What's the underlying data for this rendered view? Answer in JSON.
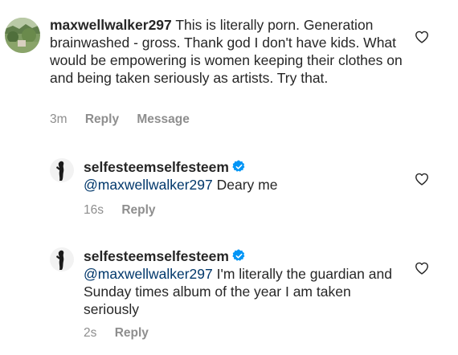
{
  "comments": [
    {
      "username": "maxwellwalker297",
      "verified": false,
      "mention": "",
      "text": "This is literally porn. Generation brainwashed - gross. Thank god I don't have kids. What would be empowering is women keeping their clothes on and being taken seriously as artists. Try that.",
      "time": "3m",
      "reply_label": "Reply",
      "message_label": "Message"
    },
    {
      "username": "selfesteemselfesteem",
      "verified": true,
      "mention": "@maxwellwalker297",
      "text": "Deary me",
      "time": "16s",
      "reply_label": "Reply"
    },
    {
      "username": "selfesteemselfesteem",
      "verified": true,
      "mention": "@maxwellwalker297",
      "text": "I'm literally the guardian and Sunday times album of the year I am taken seriously",
      "time": "2s",
      "reply_label": "Reply"
    }
  ],
  "icons": {
    "like": "heart-outline-icon",
    "verified": "verified-badge-icon"
  },
  "colors": {
    "text": "#262626",
    "secondary": "#8e8e8e",
    "mention": "#00376b",
    "verified": "#0095f6"
  }
}
